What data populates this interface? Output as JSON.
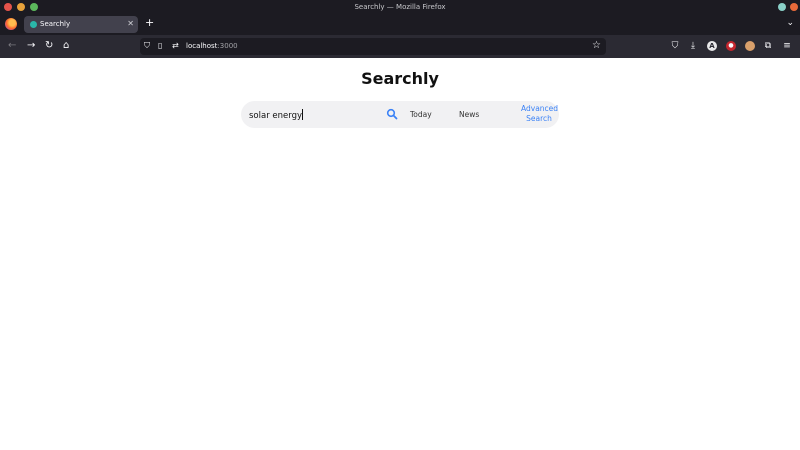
{
  "window": {
    "title": "Searchly — Mozilla Firefox"
  },
  "tabs": [
    {
      "label": "Searchly",
      "active": true
    }
  ],
  "urlbar": {
    "host": "localhost",
    "port": ":3000"
  },
  "page": {
    "brand": "Searchly",
    "search": {
      "query": "solar energy",
      "filters": [
        "Today",
        "News"
      ],
      "advanced_line1": "Advanced",
      "advanced_line2": "Search"
    }
  },
  "colors": {
    "link": "#3b82f6",
    "search_bg": "#f1f1f3",
    "chrome_dark": "#1c1b22",
    "toolbar": "#2b2a33"
  },
  "icons": [
    "firefox-icon",
    "back-icon",
    "forward-icon",
    "reload-icon",
    "home-icon",
    "shield-icon",
    "page-icon",
    "permissions-icon",
    "bookmark-star-icon",
    "pocket-icon",
    "download-icon",
    "account-icon",
    "extension-icon",
    "avatar-icon",
    "extensions-puzzle-icon",
    "menu-icon",
    "search-icon"
  ]
}
